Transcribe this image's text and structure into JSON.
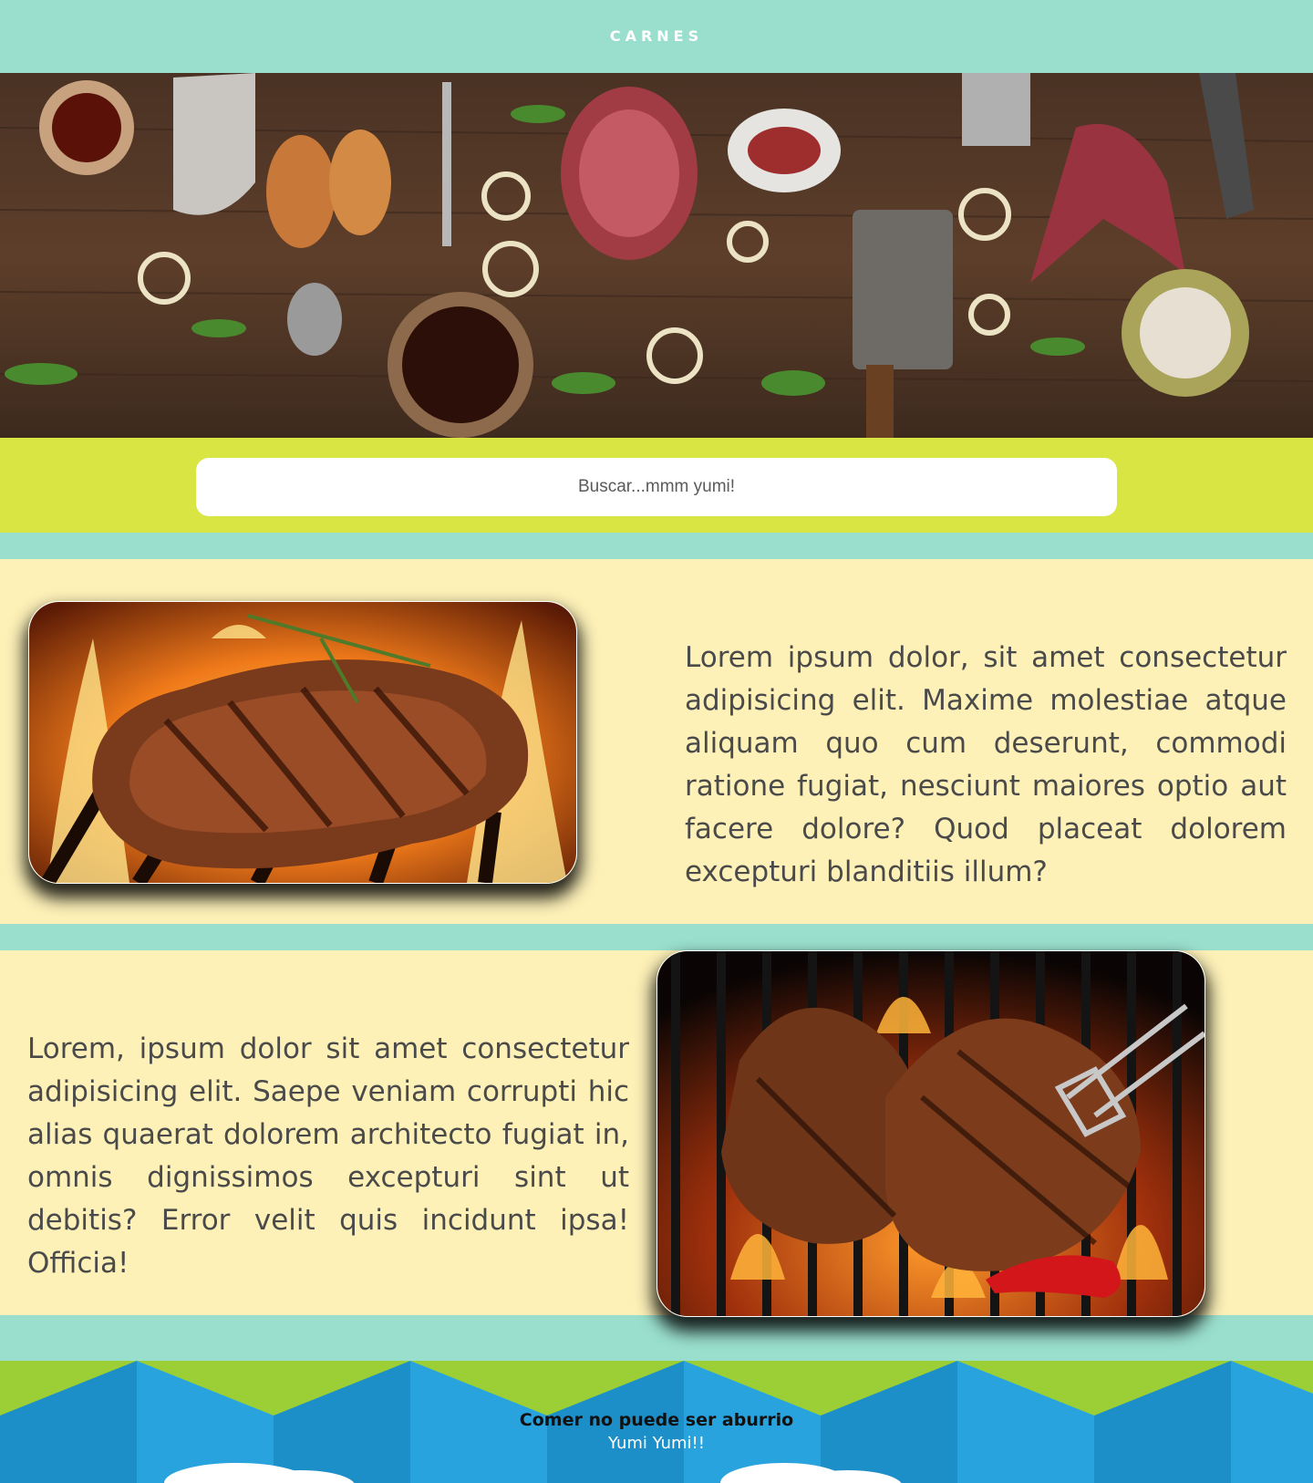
{
  "header": {
    "title": "CARNES"
  },
  "hero": {
    "image": "meat-and-kitchen-tools-banner"
  },
  "search": {
    "placeholder": "Buscar...mmm yumi!"
  },
  "sections": [
    {
      "image": "grilled-steak-with-rosemary",
      "text": "Lorem ipsum dolor, sit amet consectetur adipisicing elit. Maxime molestiae atque aliquam quo cum deserunt, commodi ratione fugiat, nesciunt maiores optio aut facere dolore? Quod placeat dolorem excepturi blanditiis illum?"
    },
    {
      "image": "t-bone-steaks-on-flaming-grill",
      "text": "Lorem, ipsum dolor sit amet consectetur adipisicing elit. Saepe veniam corrupti hic alias quaerat dolorem architecto fugiat in, omnis dignissimos excepturi sint ut debitis? Error velit quis incidunt ipsa! Officia!"
    }
  ],
  "footer": {
    "tagline": "Comer no puede ser aburrio",
    "subtitle": "Yumi Yumi!!"
  },
  "colors": {
    "mint": "#9adfcd",
    "lime": "#d9e542",
    "cream": "#fdf1b8",
    "footer_green": "#9bcf35",
    "footer_blue": "#29a3dd"
  }
}
